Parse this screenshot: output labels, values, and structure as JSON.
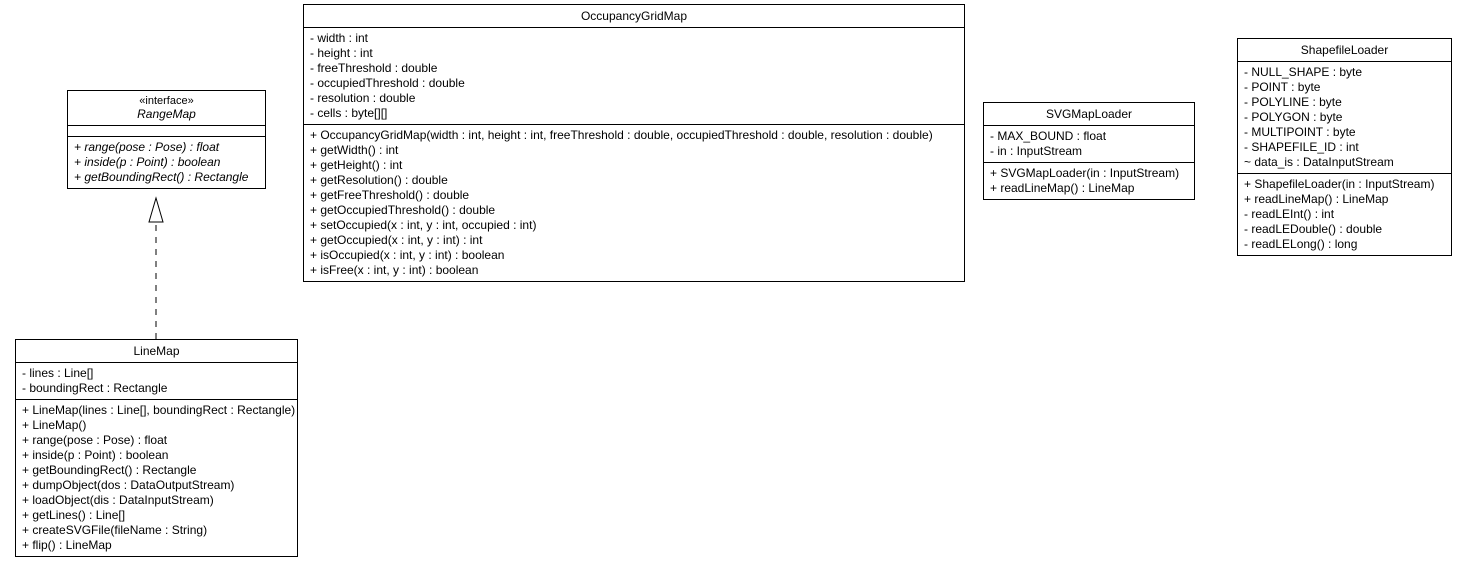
{
  "rangeMap": {
    "stereotype": "«interface»",
    "name": "RangeMap",
    "ops": [
      "+ range(pose : Pose) : float",
      "+ inside(p : Point) : boolean",
      "+ getBoundingRect() : Rectangle"
    ]
  },
  "occupancyGridMap": {
    "name": "OccupancyGridMap",
    "attrs": [
      "- width : int",
      "- height : int",
      "- freeThreshold : double",
      "- occupiedThreshold : double",
      "- resolution : double",
      "- cells : byte[][]"
    ],
    "ops": [
      "+ OccupancyGridMap(width : int, height : int, freeThreshold : double, occupiedThreshold : double, resolution : double)",
      "+ getWidth() : int",
      "+ getHeight() : int",
      "+ getResolution() : double",
      "+ getFreeThreshold() : double",
      "+ getOccupiedThreshold() : double",
      "+ setOccupied(x : int, y : int, occupied : int)",
      "+ getOccupied(x : int, y : int) : int",
      "+ isOccupied(x : int, y : int) : boolean",
      "+ isFree(x : int, y : int) : boolean"
    ]
  },
  "svgMapLoader": {
    "name": "SVGMapLoader",
    "attrs": [
      "- MAX_BOUND : float",
      "- in : InputStream"
    ],
    "ops": [
      "+ SVGMapLoader(in : InputStream)",
      "+ readLineMap() : LineMap"
    ]
  },
  "shapefileLoader": {
    "name": "ShapefileLoader",
    "attrs": [
      "- NULL_SHAPE : byte",
      "- POINT : byte",
      "- POLYLINE : byte",
      "- POLYGON : byte",
      "- MULTIPOINT : byte",
      "- SHAPEFILE_ID : int",
      "~ data_is : DataInputStream"
    ],
    "ops": [
      "+ ShapefileLoader(in : InputStream)",
      "+ readLineMap() : LineMap",
      "- readLEInt() : int",
      "- readLEDouble() : double",
      "- readLELong() : long"
    ]
  },
  "lineMap": {
    "name": "LineMap",
    "attrs": [
      "- lines : Line[]",
      "- boundingRect : Rectangle"
    ],
    "ops": [
      "+ LineMap(lines : Line[], boundingRect : Rectangle)",
      "+ LineMap()",
      "+ range(pose : Pose) : float",
      "+ inside(p : Point) : boolean",
      "+ getBoundingRect() : Rectangle",
      "+ dumpObject(dos : DataOutputStream)",
      "+ loadObject(dis : DataInputStream)",
      "+ getLines() : Line[]",
      "+ createSVGFile(fileName : String)",
      "+ flip() : LineMap"
    ]
  }
}
